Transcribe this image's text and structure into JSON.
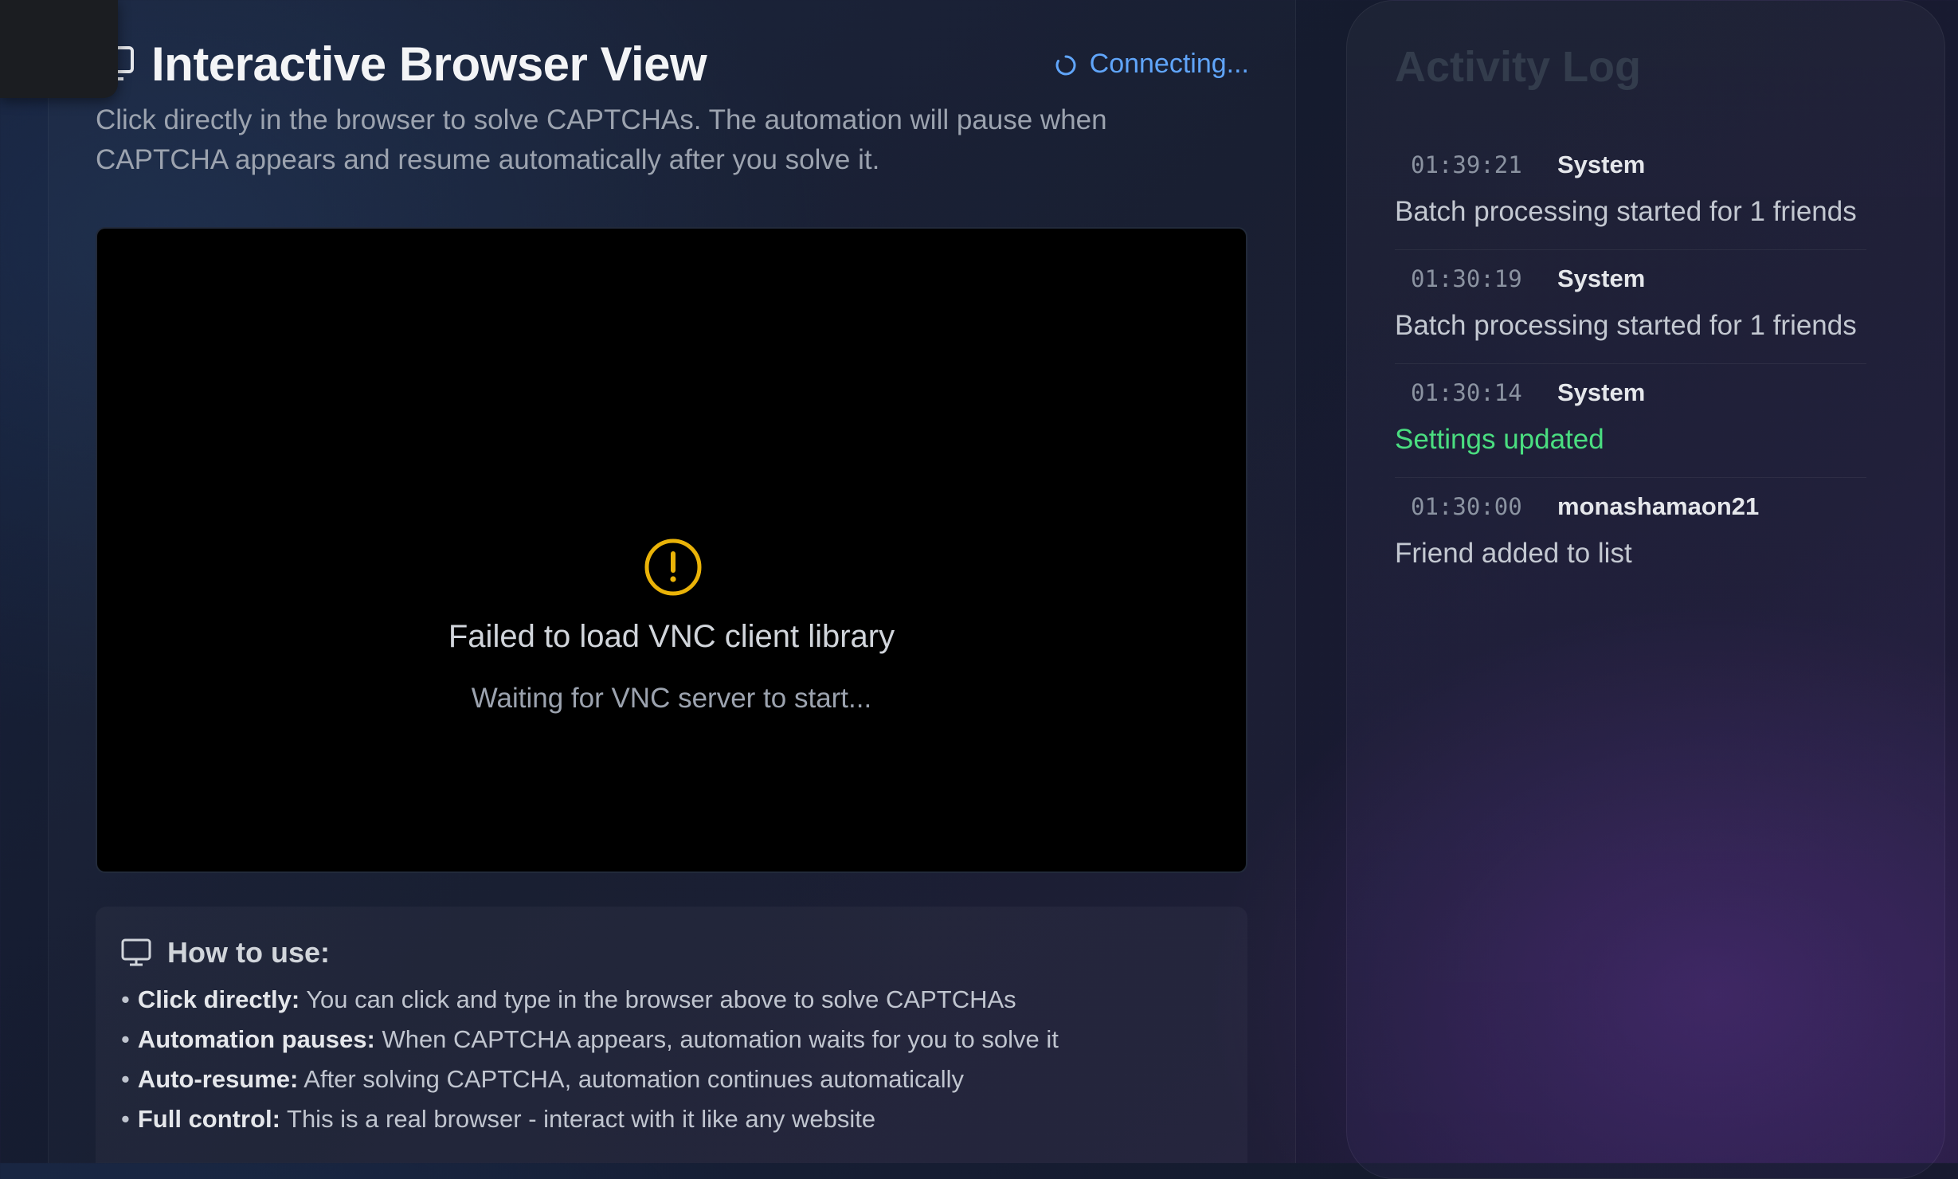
{
  "header": {
    "title": "Interactive Browser View",
    "status": "Connecting..."
  },
  "subtitle": "Click directly in the browser to solve CAPTCHAs. The automation will pause when CAPTCHA appears and resume automatically after you solve it.",
  "vnc": {
    "error": "Failed to load VNC client library",
    "waiting": "Waiting for VNC server to start..."
  },
  "howto": {
    "title": "How to use:",
    "items": [
      {
        "label": "Click directly:",
        "text": " You can click and type in the browser above to solve CAPTCHAs"
      },
      {
        "label": "Automation pauses:",
        "text": " When CAPTCHA appears, automation waits for you to solve it"
      },
      {
        "label": "Auto-resume:",
        "text": " After solving CAPTCHA, automation continues automatically"
      },
      {
        "label": "Full control:",
        "text": " This is a real browser - interact with it like any website"
      }
    ]
  },
  "activity_log": {
    "title": "Activity Log",
    "entries": [
      {
        "time": "01:39:21",
        "source": "System",
        "message": "Batch processing started for 1 friends"
      },
      {
        "time": "01:30:19",
        "source": "System",
        "message": "Batch processing started for 1 friends"
      },
      {
        "time": "01:30:14",
        "source": "System",
        "message": "Settings updated"
      },
      {
        "time": "01:30:00",
        "source": "monashamaon21",
        "message": "Friend added to list"
      }
    ]
  },
  "colors": {
    "status_blue": "#60a5fa",
    "warning_amber": "#eab308",
    "success_green": "#4ade80"
  },
  "icons": [
    "monitor-icon",
    "spinner-icon",
    "warning-icon"
  ]
}
